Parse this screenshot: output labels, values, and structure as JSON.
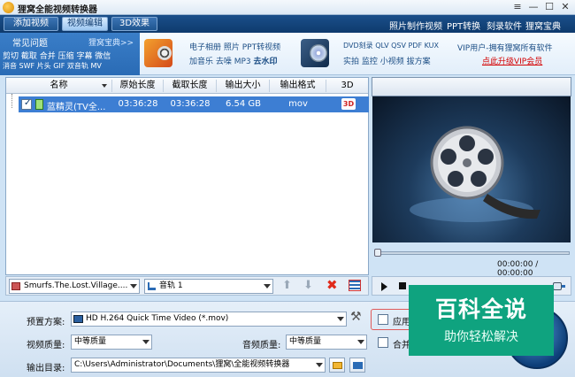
{
  "titlebar": {
    "title": "狸窝全能视频转换器",
    "min": "—",
    "restore": "☐",
    "close": "✕",
    "menu": "≡"
  },
  "tabs": [
    {
      "label": "添加视频"
    },
    {
      "label": "视频编辑"
    },
    {
      "label": "3D效果"
    }
  ],
  "top_links": [
    "照片制作视频",
    "PPT转换",
    "刻录软件",
    "狸窝宝典"
  ],
  "faq": {
    "title": "常见问题",
    "link": "狸窝宝典>>",
    "line1": "剪切 截取 合并 压缩 字幕 微信",
    "line2": "消音 SWF 片头 GIF 双音轨 MV"
  },
  "promo1": {
    "line1": "电子相册 照片 PPT转视频",
    "line2_a": "加音乐 去噪 MP3 ",
    "line2_b": "去水印"
  },
  "promo2": {
    "line1": "DVD刻录 QLV QSV PDF KUX",
    "line2": "实拍 监控 小视频 拔方案"
  },
  "vip": {
    "line1": "VIP用户-拥有狸窝所有软件",
    "line2": "点此升级VIP会员",
    "color": "#d40000"
  },
  "file_list": {
    "columns": [
      "名称",
      "原始长度",
      "截取长度",
      "输出大小",
      "输出格式",
      "3D"
    ],
    "rows": [
      {
        "name": "蓝精灵(TV全...",
        "orig": "03:36:28",
        "cut": "03:36:28",
        "size": "6.54 GB",
        "format": "mov",
        "three_d": "3D"
      }
    ]
  },
  "preview": {
    "time": "00:00:00 / 00:00:00"
  },
  "file_toolbar": {
    "file_select": "Smurfs.The.Lost.Village....",
    "audio_track": "音轨 1"
  },
  "settings": {
    "preset_label": "预置方案:",
    "preset_value": "HD H.264 Quick Time Video (*.mov)",
    "video_quality_label": "视频质量:",
    "video_quality_value": "中等质量",
    "audio_quality_label": "音频质量:",
    "audio_quality_value": "中等质量",
    "output_label": "输出目录:",
    "output_value": "C:\\Users\\Administrator\\Documents\\狸窝\\全能视频转换器",
    "apply_all": "应用",
    "merge": "合并"
  },
  "watermark": {
    "big": "百科全说",
    "small": "助你轻松解决"
  },
  "colors": {
    "accent": "#3d7ed3",
    "header_band": "#0e3a6d",
    "watermark": "#0fa37f"
  }
}
